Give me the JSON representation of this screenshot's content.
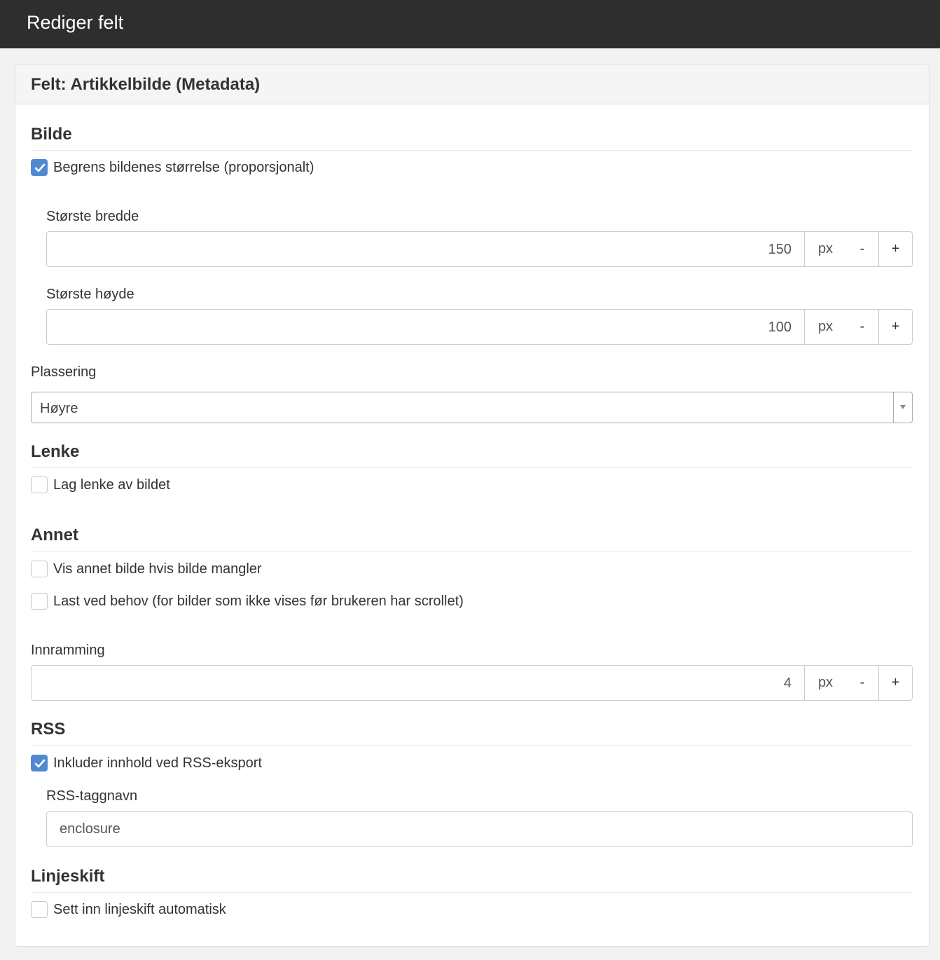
{
  "window": {
    "title": "Rediger felt"
  },
  "panel": {
    "title": "Felt: Artikkelbilde (Metadata)"
  },
  "image": {
    "section_title": "Bilde",
    "limit_size": {
      "label": "Begrens bildenes størrelse (proporsjonalt)",
      "checked": true
    },
    "max_width": {
      "label": "Største bredde",
      "value": "150",
      "unit": "px",
      "minus": "-",
      "plus": "+"
    },
    "max_height": {
      "label": "Største høyde",
      "value": "100",
      "unit": "px",
      "minus": "-",
      "plus": "+"
    },
    "placement": {
      "label": "Plassering",
      "selected": "Høyre"
    }
  },
  "link": {
    "section_title": "Lenke",
    "make_link": {
      "label": "Lag lenke av bildet",
      "checked": false
    }
  },
  "other": {
    "section_title": "Annet",
    "fallback_image": {
      "label": "Vis annet bilde hvis bilde mangler",
      "checked": false
    },
    "lazy_load": {
      "label": "Last ved behov (for bilder som ikke vises før brukeren har scrollet)",
      "checked": false
    },
    "border": {
      "label": "Innramming",
      "value": "4",
      "unit": "px",
      "minus": "-",
      "plus": "+"
    }
  },
  "rss": {
    "section_title": "RSS",
    "include": {
      "label": "Inkluder innhold ved RSS-eksport",
      "checked": true
    },
    "tag_name": {
      "label": "RSS-taggnavn",
      "value": "enclosure"
    }
  },
  "line_breaks": {
    "section_title": "Linjeskift",
    "auto": {
      "label": "Sett inn linjeskift automatisk",
      "checked": false
    }
  },
  "colors": {
    "titlebar": "#2e2e2e",
    "accent": "#4f8ad1"
  },
  "icons": {
    "check": "check-icon",
    "dropdown": "chevron-down-icon"
  }
}
